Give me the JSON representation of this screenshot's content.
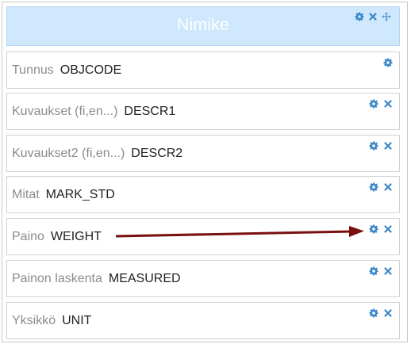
{
  "header": {
    "title": "Nimike"
  },
  "rows": [
    {
      "label": "Tunnus",
      "value": "OBJCODE"
    },
    {
      "label": "Kuvaukset (fi,en...)",
      "value": "DESCR1"
    },
    {
      "label": "Kuvaukset2 (fi,en...)",
      "value": "DESCR2"
    },
    {
      "label": "Mitat",
      "value": "MARK_STD"
    },
    {
      "label": "Paino",
      "value": "WEIGHT"
    },
    {
      "label": "Painon laskenta",
      "value": "MEASURED"
    },
    {
      "label": "Yksikkö",
      "value": "UNIT"
    }
  ],
  "colors": {
    "icon": "#3a86c8",
    "header_bg": "#cfe8fd",
    "arrow": "#7a0f0f"
  }
}
